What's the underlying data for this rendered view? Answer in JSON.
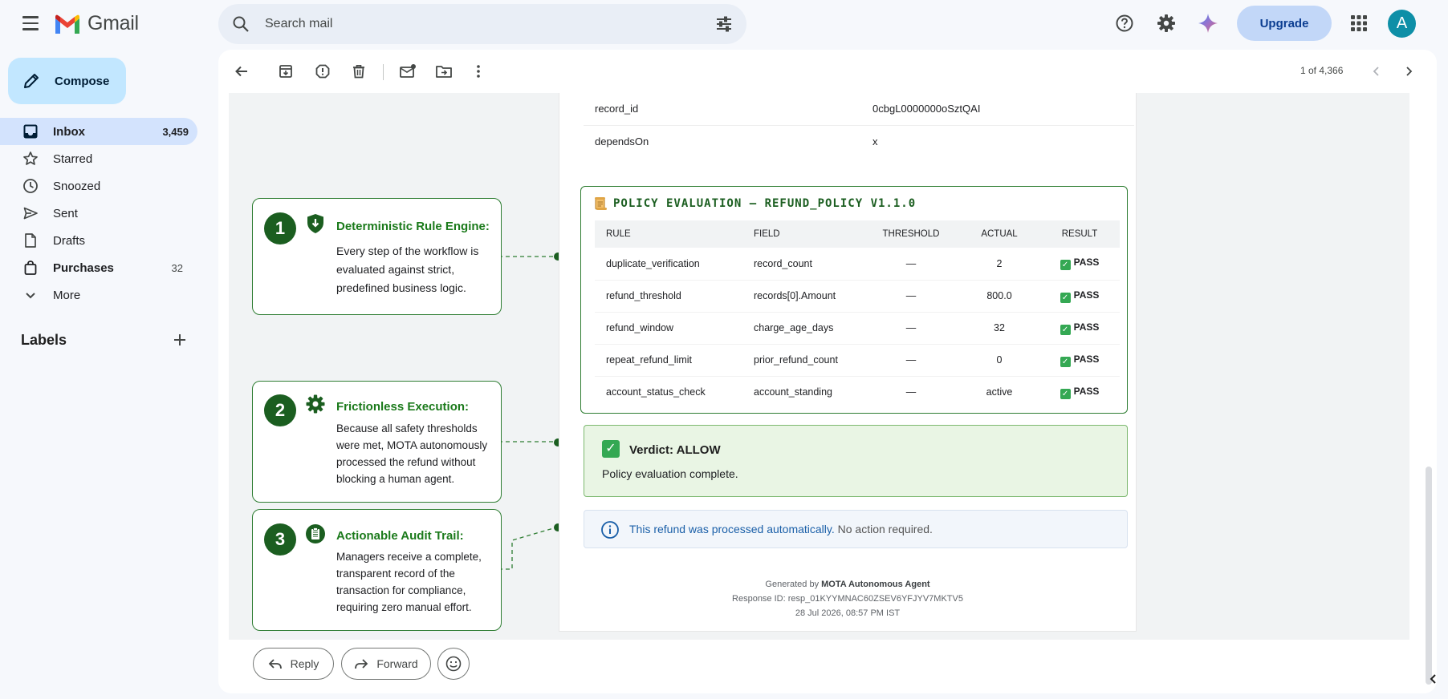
{
  "app": {
    "name": "Gmail"
  },
  "search": {
    "placeholder": "Search mail"
  },
  "topbar": {
    "upgrade_label": "Upgrade",
    "avatar_letter": "A"
  },
  "sidebar": {
    "compose_label": "Compose",
    "items": [
      {
        "label": "Inbox",
        "count": "3,459",
        "icon": "inbox-icon"
      },
      {
        "label": "Starred",
        "count": "",
        "icon": "star-icon"
      },
      {
        "label": "Snoozed",
        "count": "",
        "icon": "clock-icon"
      },
      {
        "label": "Sent",
        "count": "",
        "icon": "send-icon"
      },
      {
        "label": "Drafts",
        "count": "",
        "icon": "draft-icon"
      },
      {
        "label": "Purchases",
        "count": "32",
        "icon": "bag-icon"
      },
      {
        "label": "More",
        "count": "",
        "icon": "chevron-down-icon"
      }
    ],
    "labels_heading": "Labels"
  },
  "toolbar": {
    "pager": "1 of 4,366"
  },
  "email": {
    "kv": [
      {
        "key": "record_id",
        "value": "0cbgL0000000oSztQAI"
      },
      {
        "key": "dependsOn",
        "value": "x"
      }
    ],
    "policy": {
      "title": "POLICY EVALUATION — REFUND_POLICY V1.1.0",
      "headers": [
        "RULE",
        "FIELD",
        "THRESHOLD",
        "ACTUAL",
        "RESULT"
      ],
      "rows": [
        {
          "rule": "duplicate_verification",
          "field": "record_count",
          "threshold": "—",
          "actual": "2",
          "result": "PASS"
        },
        {
          "rule": "refund_threshold",
          "field": "records[0].Amount",
          "threshold": "—",
          "actual": "800.0",
          "result": "PASS"
        },
        {
          "rule": "refund_window",
          "field": "charge_age_days",
          "threshold": "—",
          "actual": "32",
          "result": "PASS"
        },
        {
          "rule": "repeat_refund_limit",
          "field": "prior_refund_count",
          "threshold": "—",
          "actual": "0",
          "result": "PASS"
        },
        {
          "rule": "account_status_check",
          "field": "account_standing",
          "threshold": "—",
          "actual": "active",
          "result": "PASS"
        }
      ]
    },
    "verdict": {
      "title": "Verdict: ALLOW",
      "subtitle": "Policy evaluation complete."
    },
    "info": {
      "link_text": "This refund was processed automatically.",
      "rest_text": " No action required."
    },
    "footer": {
      "generated_prefix": "Generated by ",
      "generated_by": "MOTA Autonomous Agent",
      "response_id": "Response ID: resp_01KYYMNAC60ZSEV6YFJYV7MKTV5",
      "timestamp": "28 Jul 2026, 08:57 PM IST"
    }
  },
  "callouts": [
    {
      "number": "1",
      "icon": "shield-icon",
      "title": "Deterministic Rule Engine:",
      "body": "Every step of the workflow is evaluated against strict, predefined business logic."
    },
    {
      "number": "2",
      "icon": "gear-icon",
      "title": "Frictionless Execution:",
      "body": "Because all safety thresholds were met, MOTA autonomously processed the refund without blocking a human agent."
    },
    {
      "number": "3",
      "icon": "clipboard-icon",
      "title": "Actionable Audit Trail:",
      "body": "Managers receive a complete, transparent record of the transaction for compliance, requiring zero manual effort."
    }
  ],
  "reply_bar": {
    "reply_label": "Reply",
    "forward_label": "Forward"
  },
  "colors": {
    "accent_green": "#1b5e20",
    "pass_green": "#1e8e3e",
    "compose_bg": "#c2e7ff",
    "upgrade_bg": "#c2d7f8"
  }
}
